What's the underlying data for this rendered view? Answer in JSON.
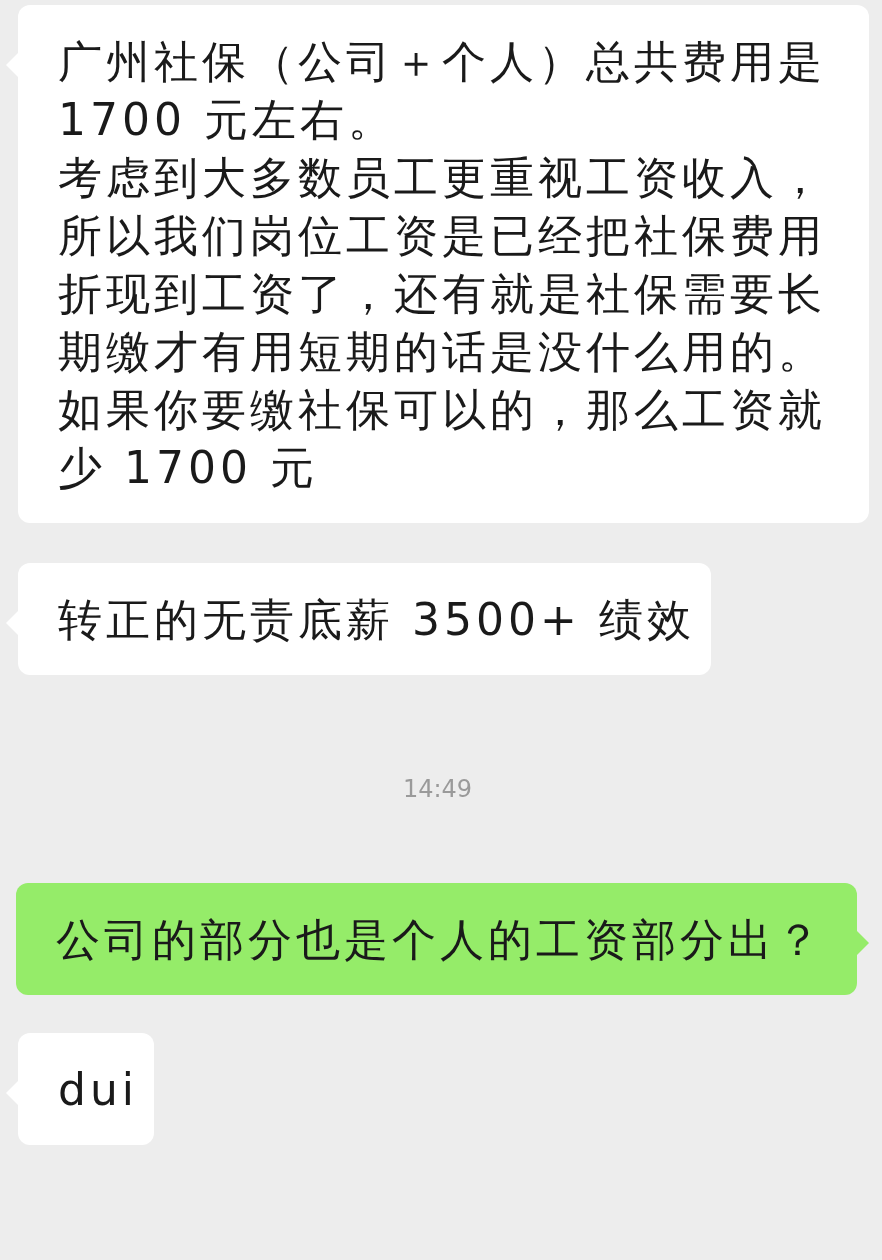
{
  "messages": [
    {
      "kind": "incoming",
      "paragraphs": [
        "广州社保（公司＋个人）总共费用是 1700 元左右。",
        "考虑到大多数员工更重视工资收入，所以我们岗位工资是已经把社保费用折现到工资了，还有就是社保需要长期缴才有用短期的话是没什么用的。如果你要缴社保可以的，那么工资就少 1700 元"
      ]
    },
    {
      "kind": "incoming",
      "paragraphs": [
        "转正的无责底薪 3500+ 绩效"
      ]
    },
    {
      "kind": "time",
      "paragraphs": [
        "14:49"
      ]
    },
    {
      "kind": "outgoing",
      "paragraphs": [
        "公司的部分也是个人的工资部分出？"
      ]
    },
    {
      "kind": "incoming",
      "paragraphs": [
        "dui"
      ]
    }
  ]
}
